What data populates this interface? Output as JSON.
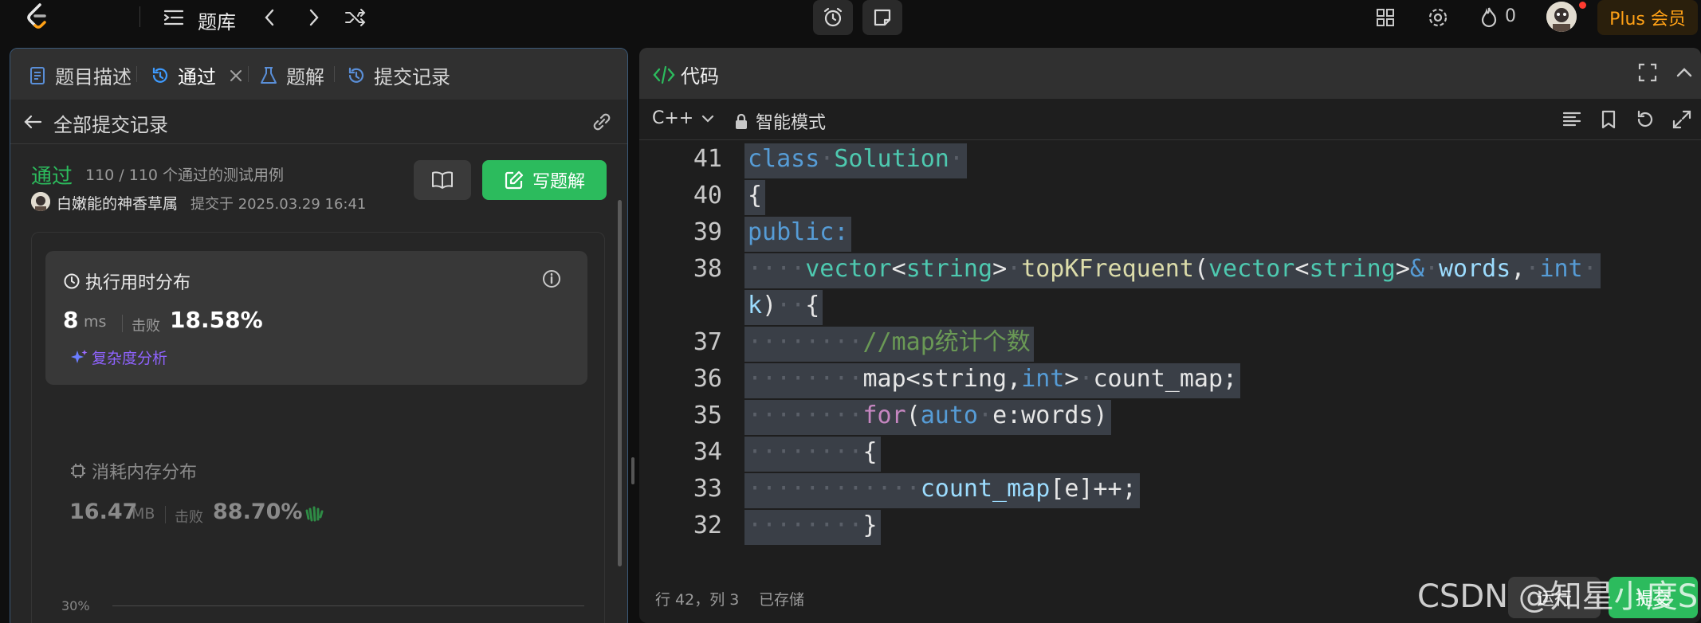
{
  "topbar": {
    "problem_bank_label": "题库",
    "fire_count": "0",
    "plus_label": "Plus 会员"
  },
  "left_panel": {
    "tabs": [
      {
        "label": "题目描述"
      },
      {
        "label": "通过"
      },
      {
        "label": "题解"
      },
      {
        "label": "提交记录"
      }
    ],
    "sub_title": "全部提交记录",
    "status": "通过",
    "case_count": "110 / 110 个通过的测试用例",
    "user_name": "白嫩能的神香草属",
    "submitted_at": "提交于 2025.03.29 16:41",
    "write_solution_label": "写题解",
    "runtime": {
      "title": "执行用时分布",
      "value": "8",
      "unit": "ms",
      "beat_label": "击败",
      "beat_percent": "18.58%",
      "complexity_link": "复杂度分析"
    },
    "memory": {
      "title": "消耗内存分布",
      "value": "16.47",
      "unit": "MB",
      "beat_label": "击败",
      "beat_percent": "88.70%"
    },
    "chart_axis_label": "30%"
  },
  "right_panel": {
    "title": "代码",
    "language": "C++",
    "mode": "智能模式",
    "cursor_pos": "行 42，列 3",
    "save_status": "已存储",
    "run_label": "运行",
    "submit_label": "提交",
    "lines": [
      {
        "num": "41",
        "text": "class Solution "
      },
      {
        "num": "40",
        "text": "{"
      },
      {
        "num": "39",
        "text": "public:"
      },
      {
        "num": "38",
        "text": "    vector<string> topKFrequent(vector<string>& words, int"
      },
      {
        "num": "",
        "text": "k)  {"
      },
      {
        "num": "37",
        "text": "        //map统计个数"
      },
      {
        "num": "36",
        "text": "        map<string,int> count_map;"
      },
      {
        "num": "35",
        "text": "        for(auto e:words)"
      },
      {
        "num": "34",
        "text": "        {"
      },
      {
        "num": "33",
        "text": "            count_map[e]++;"
      },
      {
        "num": "32",
        "text": "        }"
      }
    ]
  },
  "watermark": "CSDN @知星小度S",
  "colors": {
    "accent_green": "#2cbb5d",
    "plus_orange": "#ffa116",
    "complexity_purple": "#8f63ff"
  }
}
